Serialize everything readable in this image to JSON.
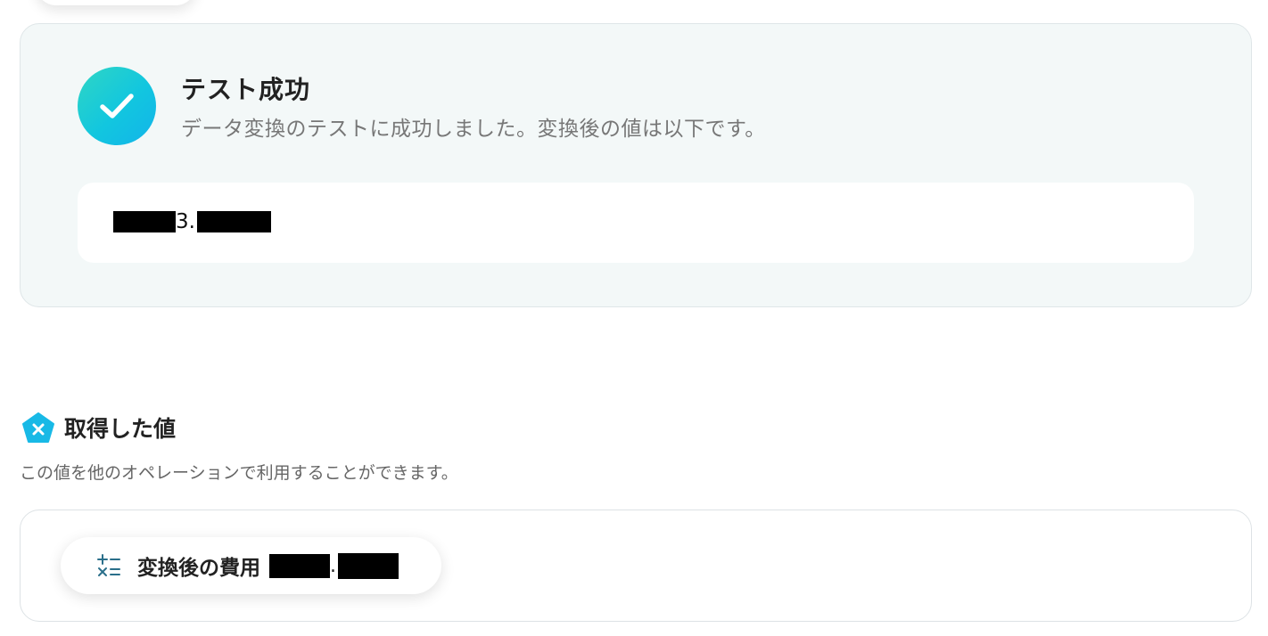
{
  "success": {
    "title": "テスト成功",
    "message": "データ変換のテストに成功しました。変換後の値は以下です。",
    "value_visible": "3.",
    "accent_color": "#12c6df"
  },
  "output_section": {
    "title": "取得した値",
    "description": "この値を他のオペレーションで利用することができます。",
    "items": [
      {
        "label": "変換後の費用",
        "value_visible": ".",
        "icon": "calculator-icon"
      }
    ]
  }
}
